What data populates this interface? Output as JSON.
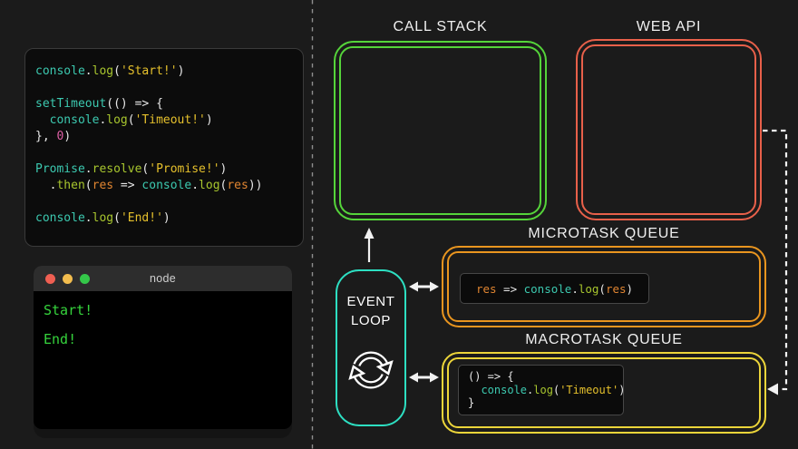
{
  "title": "JavaScript event loop diagram",
  "colors": {
    "background": "#1b1b1b",
    "callStackBorder": "#55d43a",
    "webApiBorder": "#e8604a",
    "microtaskBorder": "#e9951f",
    "macrotaskBorder": "#ecd53a",
    "eventLoopBorder": "#2ddfc2",
    "terminalGreen": "#35d33c",
    "codeTeal": "#3cc9b0",
    "codeGreen": "#a8c62e",
    "codeYellow": "#e5c02c",
    "codeOrange": "#e08531",
    "codePink": "#dd5fa4"
  },
  "code_panel": {
    "lines": [
      [
        {
          "t": "console",
          "c": "fn"
        },
        {
          "t": ".",
          "c": "plain"
        },
        {
          "t": "log",
          "c": "method"
        },
        {
          "t": "(",
          "c": "plain"
        },
        {
          "t": "'Start!'",
          "c": "str"
        },
        {
          "t": ")",
          "c": "plain"
        }
      ],
      [],
      [
        {
          "t": "setTimeout",
          "c": "fn"
        },
        {
          "t": "(() => {",
          "c": "plain"
        }
      ],
      [
        {
          "t": "  ",
          "c": "plain"
        },
        {
          "t": "console",
          "c": "fn"
        },
        {
          "t": ".",
          "c": "plain"
        },
        {
          "t": "log",
          "c": "method"
        },
        {
          "t": "(",
          "c": "plain"
        },
        {
          "t": "'Timeout!'",
          "c": "str"
        },
        {
          "t": ")",
          "c": "plain"
        }
      ],
      [
        {
          "t": "}, ",
          "c": "plain"
        },
        {
          "t": "0",
          "c": "num"
        },
        {
          "t": ")",
          "c": "plain"
        }
      ],
      [],
      [
        {
          "t": "Promise",
          "c": "fn"
        },
        {
          "t": ".",
          "c": "plain"
        },
        {
          "t": "resolve",
          "c": "method"
        },
        {
          "t": "(",
          "c": "plain"
        },
        {
          "t": "'Promise!'",
          "c": "str"
        },
        {
          "t": ")",
          "c": "plain"
        }
      ],
      [
        {
          "t": "  .",
          "c": "plain"
        },
        {
          "t": "then",
          "c": "method"
        },
        {
          "t": "(",
          "c": "plain"
        },
        {
          "t": "res",
          "c": "arg"
        },
        {
          "t": " => ",
          "c": "plain"
        },
        {
          "t": "console",
          "c": "fn"
        },
        {
          "t": ".",
          "c": "plain"
        },
        {
          "t": "log",
          "c": "method"
        },
        {
          "t": "(",
          "c": "plain"
        },
        {
          "t": "res",
          "c": "arg"
        },
        {
          "t": "))",
          "c": "plain"
        }
      ],
      [],
      [
        {
          "t": "console",
          "c": "fn"
        },
        {
          "t": ".",
          "c": "plain"
        },
        {
          "t": "log",
          "c": "method"
        },
        {
          "t": "(",
          "c": "plain"
        },
        {
          "t": "'End!'",
          "c": "str"
        },
        {
          "t": ")",
          "c": "plain"
        }
      ]
    ]
  },
  "terminal": {
    "title": "node",
    "lines": [
      "Start!",
      "End!"
    ]
  },
  "diagram": {
    "call_stack_label": "CALL STACK",
    "web_api_label": "WEB API",
    "microtask_label": "MICROTASK QUEUE",
    "macrotask_label": "MACROTASK QUEUE",
    "event_loop_label_line1": "EVENT",
    "event_loop_label_line2": "LOOP",
    "microtask_chip": {
      "lines": [
        [
          {
            "t": "res",
            "c": "arg"
          },
          {
            "t": " => ",
            "c": "plain"
          },
          {
            "t": "console",
            "c": "fn"
          },
          {
            "t": ".",
            "c": "plain"
          },
          {
            "t": "log",
            "c": "method"
          },
          {
            "t": "(",
            "c": "plain"
          },
          {
            "t": "res",
            "c": "arg"
          },
          {
            "t": ")",
            "c": "plain"
          }
        ]
      ]
    },
    "macrotask_chip": {
      "lines": [
        [
          {
            "t": "() => {",
            "c": "plain"
          }
        ],
        [
          {
            "t": "  ",
            "c": "plain"
          },
          {
            "t": "console",
            "c": "fn"
          },
          {
            "t": ".",
            "c": "plain"
          },
          {
            "t": "log",
            "c": "method"
          },
          {
            "t": "(",
            "c": "plain"
          },
          {
            "t": "'Timeout'",
            "c": "str"
          },
          {
            "t": ")",
            "c": "plain"
          }
        ],
        [
          {
            "t": "}",
            "c": "plain"
          }
        ]
      ]
    }
  }
}
